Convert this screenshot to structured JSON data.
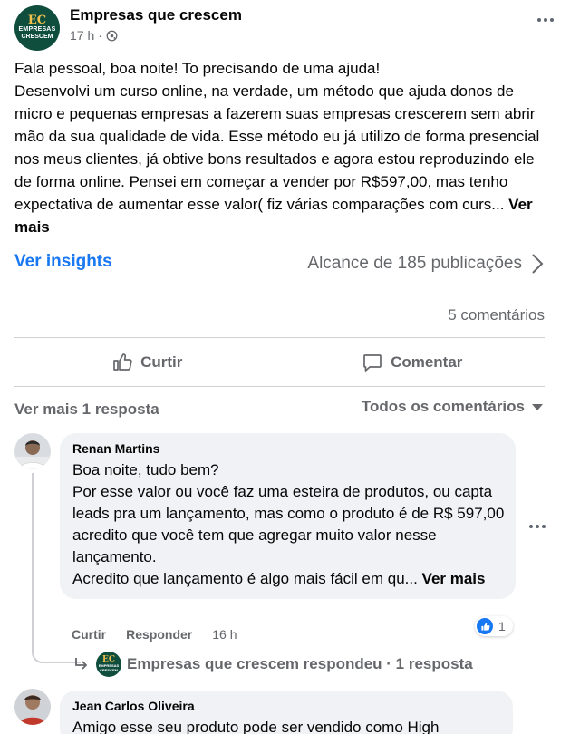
{
  "post": {
    "page_name": "Empresas que crescem",
    "logo_mark": "EC",
    "logo_line1": "EMPRESAS",
    "logo_line2": "CRESCEM",
    "timestamp": "17 h",
    "separator": "·",
    "audience_icon": "globe-icon",
    "text_lines": [
      "Fala pessoal, boa noite! To precisando de uma ajuda!",
      "Desenvolvi um curso online, na verdade, um método que ajuda donos de micro e pequenas empresas a fazerem suas empresas crescerem sem abrir mão da sua qualidade de vida. Esse método eu já utilizo de forma presencial nos meus clientes, já obtive bons resultados e agora estou reproduzindo ele de forma online. Pensei em começar a vender por R$597,00, mas tenho expectativa de aumentar esse valor( fiz várias comparações com curs... "
    ],
    "see_more": "Ver mais"
  },
  "insights": {
    "link": "Ver insights",
    "reach": "Alcance de 185 publicações"
  },
  "comments_count": "5 comentários",
  "actions": {
    "like": "Curtir",
    "comment": "Comentar"
  },
  "comments_header": {
    "view_more": "Ver mais 1 resposta",
    "sort": "Todos os comentários"
  },
  "comments": [
    {
      "author": "Renan Martins",
      "lines": [
        "Boa noite, tudo bem?",
        "Por esse valor ou você faz uma esteira de produtos, ou capta leads pra um lançamento, mas como o produto é de R$ 597,00 acredito que você tem que agregar muito valor nesse lançamento.",
        "Acredito que lançamento é algo mais fácil em qu... "
      ],
      "see_more": "Ver mais",
      "like": "Curtir",
      "reply": "Responder",
      "time": "16 h",
      "reaction_count": "1",
      "reply_summary": "Empresas que crescem respondeu · 1 resposta"
    },
    {
      "author": "Jean Carlos Oliveira",
      "lines": [
        "Amigo esse seu produto pode ser vendido como High"
      ]
    }
  ],
  "colors": {
    "link": "#1877f2",
    "secondary_text": "#65676b",
    "bubble": "#f0f2f5",
    "brand": "#0f4d3c"
  }
}
